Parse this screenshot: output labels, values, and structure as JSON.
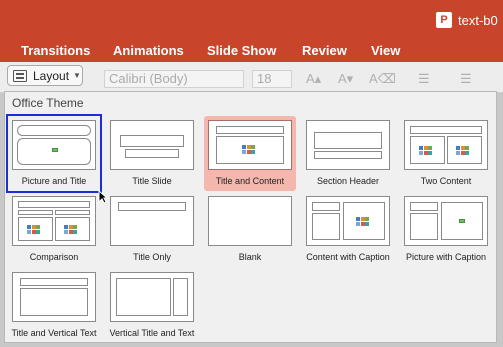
{
  "window": {
    "doc_title": "text-b0",
    "app_icon": "powerpoint-icon",
    "app_icon_letter": "P",
    "accent": "#c8442a"
  },
  "ribbon": {
    "tabs": [
      "Transitions",
      "Animations",
      "Slide Show",
      "Review",
      "View"
    ]
  },
  "toolbar": {
    "layout_label": "Layout",
    "font_name": "Calibri (Body)",
    "font_size": "18"
  },
  "gallery": {
    "section": "Office Theme",
    "layouts": [
      {
        "label": "Picture and Title"
      },
      {
        "label": "Title Slide"
      },
      {
        "label": "Title and Content"
      },
      {
        "label": "Section Header"
      },
      {
        "label": "Two Content"
      },
      {
        "label": "Comparison"
      },
      {
        "label": "Title Only"
      },
      {
        "label": "Blank"
      },
      {
        "label": "Content with Caption"
      },
      {
        "label": "Picture with Caption"
      },
      {
        "label": "Title and Vertical Text"
      },
      {
        "label": "Vertical Title and Text"
      }
    ],
    "selected": "Title and Content",
    "focused": "Picture and Title"
  }
}
